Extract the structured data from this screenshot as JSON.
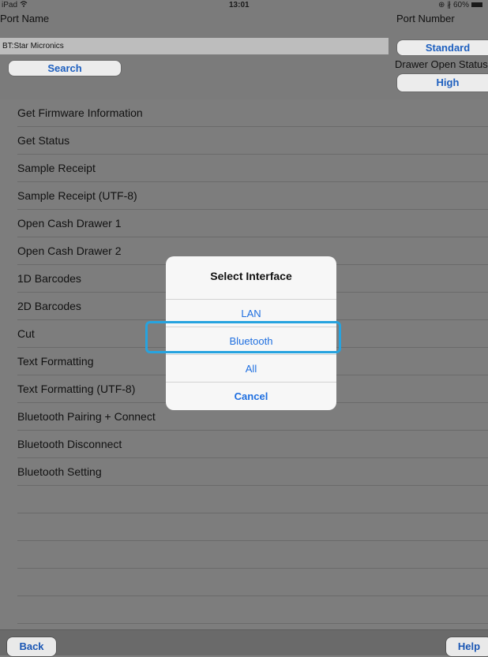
{
  "status_bar": {
    "device": "iPad",
    "time": "13:01",
    "battery": "60%"
  },
  "port_name": {
    "label": "Port Name",
    "value": "BT:Star Micronics"
  },
  "search_label": "Search",
  "port_number": {
    "label": "Port Number",
    "value": "Standard"
  },
  "drawer_open_status": {
    "label": "Drawer Open Status",
    "value": "High"
  },
  "list_items": [
    "Get Firmware Information",
    "Get Status",
    "Sample Receipt",
    "Sample Receipt (UTF-8)",
    "Open Cash Drawer 1",
    "Open Cash Drawer 2",
    "1D Barcodes",
    "2D Barcodes",
    "Cut",
    "Text Formatting",
    "Text Formatting (UTF-8)",
    "Bluetooth Pairing + Connect",
    "Bluetooth Disconnect",
    "Bluetooth Setting"
  ],
  "dialog": {
    "title": "Select Interface",
    "options": [
      "LAN",
      "Bluetooth",
      "All"
    ],
    "cancel": "Cancel",
    "highlighted_option": "Bluetooth"
  },
  "toolbar": {
    "back": "Back",
    "help": "Help"
  },
  "colors": {
    "accent": "#1f6fe0",
    "highlight": "#26a3df"
  }
}
